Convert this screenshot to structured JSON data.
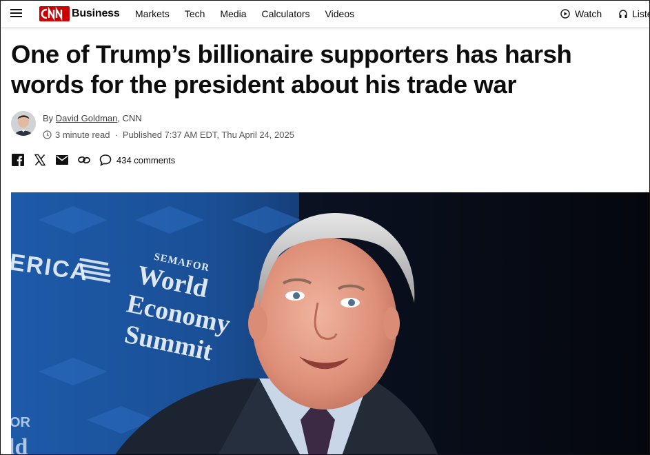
{
  "header": {
    "brand": "Business",
    "logo_text": "CNN",
    "nav": [
      "Markets",
      "Tech",
      "Media",
      "Calculators",
      "Videos"
    ],
    "watch_label": "Watch",
    "listen_label": "Listen"
  },
  "article": {
    "headline": "One of Trump’s billionaire supporters has harsh words for the president about his trade war",
    "by_prefix": "By ",
    "author": "David Goldman",
    "source": ", CNN",
    "read_time": "3 minute read",
    "separator": "·",
    "published": "Published 7:37 AM EDT, Thu April 24, 2025",
    "comments": "434 comments"
  },
  "hero_image": {
    "backdrop_text_left": "ERICA",
    "backdrop_brand_small": "SEMAFOR",
    "backdrop_event": [
      "World",
      "Economy",
      "Summit"
    ]
  },
  "colors": {
    "brand_red": "#cc0000",
    "text": "#0c0c0c",
    "meta_gray": "#555555",
    "backdrop_blue": "#1d5aa8"
  },
  "icons": [
    "menu-icon",
    "play-circle-icon",
    "headphones-icon",
    "clock-icon",
    "facebook-icon",
    "x-icon",
    "email-icon",
    "link-icon",
    "comment-icon"
  ]
}
